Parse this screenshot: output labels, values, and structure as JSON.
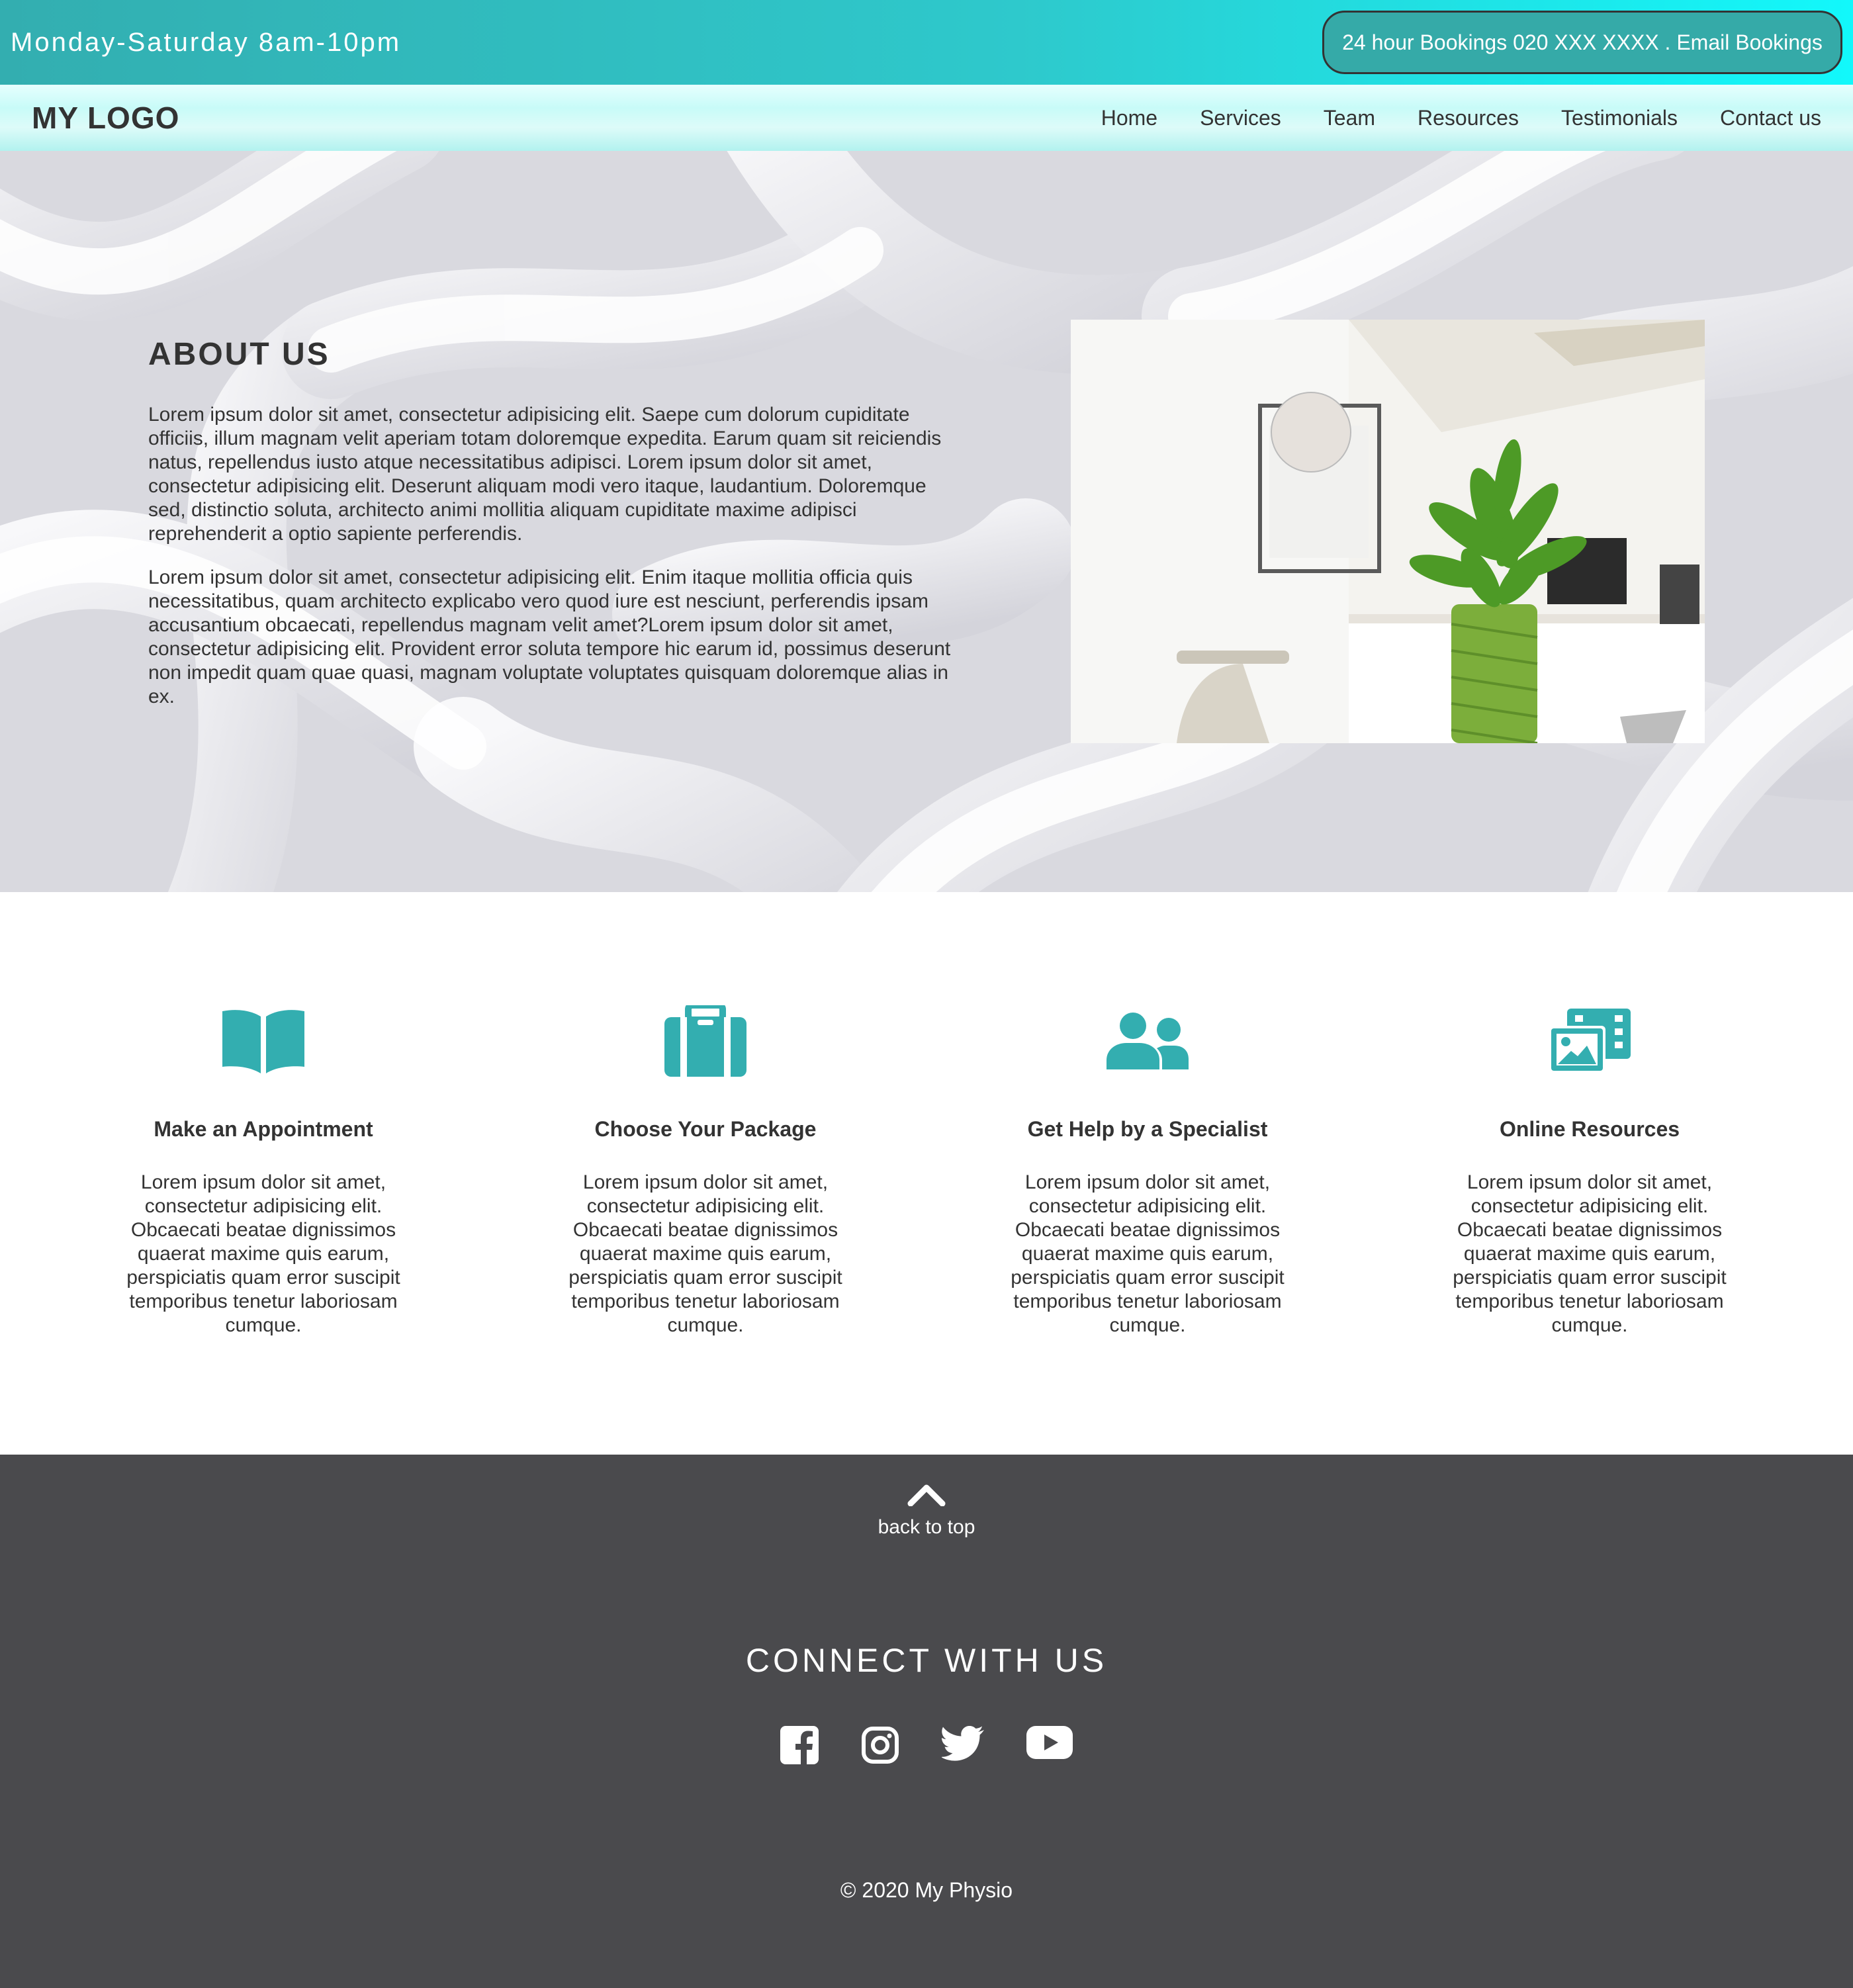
{
  "topbar": {
    "hours": "Monday-Saturday 8am-10pm",
    "booking": "24 hour Bookings 020 XXX XXXX . Email Bookings"
  },
  "navbar": {
    "logo": "MY LOGO",
    "links": [
      "Home",
      "Services",
      "Team",
      "Resources",
      "Testimonials",
      "Contact us"
    ]
  },
  "about": {
    "heading": "ABOUT US",
    "paragraphs": [
      "Lorem ipsum dolor sit amet, consectetur adipisicing elit. Saepe cum dolorum cupiditate officiis, illum magnam velit aperiam totam doloremque expedita. Earum quam sit reiciendis natus, repellendus iusto atque necessitatibus adipisci. Lorem ipsum dolor sit amet, consectetur adipisicing elit. Deserunt aliquam modi vero itaque, laudantium. Doloremque sed, distinctio soluta, architecto animi mollitia aliquam cupiditate maxime adipisci reprehenderit a optio sapiente perferendis.",
      "Lorem ipsum dolor sit amet, consectetur adipisicing elit. Enim itaque mollitia officia quis necessitatibus, quam architecto explicabo vero quod iure est nesciunt, perferendis ipsam accusantium obcaecati, repellendus magnam velit amet?Lorem ipsum dolor sit amet, consectetur adipisicing elit. Provident error soluta tempore hic earum id, possimus deserunt non impedit quam quae quasi, magnam voluptate voluptates quisquam doloremque alias in ex."
    ]
  },
  "features": [
    {
      "icon": "book-open-icon",
      "title": "Make an Appointment",
      "text": "Lorem ipsum dolor sit amet, consectetur adipisicing elit. Obcaecati beatae dignissimos quaerat maxime quis earum, perspiciatis quam error suscipit temporibus tenetur laboriosam cumque."
    },
    {
      "icon": "suitcase-icon",
      "title": "Choose Your Package",
      "text": "Lorem ipsum dolor sit amet, consectetur adipisicing elit. Obcaecati beatae dignissimos quaerat maxime quis earum, perspiciatis quam error suscipit temporibus tenetur laboriosam cumque."
    },
    {
      "icon": "users-icon",
      "title": "Get Help by a Specialist",
      "text": "Lorem ipsum dolor sit amet, consectetur adipisicing elit. Obcaecati beatae dignissimos quaerat maxime quis earum, perspiciatis quam error suscipit temporibus tenetur laboriosam cumque."
    },
    {
      "icon": "photo-video-icon",
      "title": "Online Resources",
      "text": "Lorem ipsum dolor sit amet, consectetur adipisicing elit. Obcaecati beatae dignissimos quaerat maxime quis earum, perspiciatis quam error suscipit temporibus tenetur laboriosam cumque."
    }
  ],
  "footer": {
    "back_to_top": "back to top",
    "connect": "CONNECT WITH US",
    "socials": [
      "facebook-icon",
      "instagram-icon",
      "twitter-icon",
      "youtube-icon"
    ],
    "copyright": "© 2020 My Physio"
  },
  "colors": {
    "accent": "#33aeb0",
    "footer_bg": "#4a4a4d",
    "text": "#333333"
  }
}
